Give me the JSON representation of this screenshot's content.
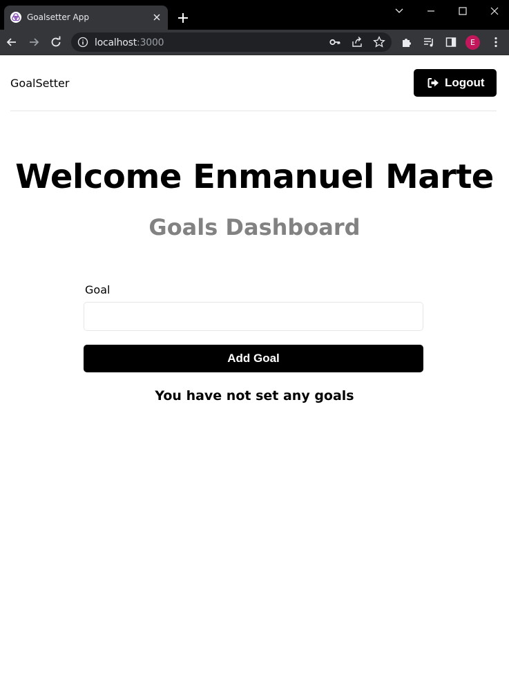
{
  "browser": {
    "tab_title": "Goalsetter App",
    "url_host": "localhost",
    "url_port": ":3000",
    "profile_initial": "E",
    "profile_color": "#c2185b",
    "icons": [
      "app-favicon-icon",
      "close-tab-icon",
      "new-tab-icon",
      "chevron-down-icon",
      "minimize-icon",
      "maximize-icon",
      "close-window-icon",
      "back-icon",
      "forward-icon",
      "reload-icon",
      "info-icon",
      "key-icon",
      "share-icon",
      "star-icon",
      "extensions-icon",
      "media-icon",
      "side-panel-icon",
      "menu-icon"
    ]
  },
  "header": {
    "brand": "GoalSetter",
    "logout_label": "Logout",
    "logout_icon": "sign-out-icon"
  },
  "main": {
    "welcome": "Welcome Enmanuel Marte",
    "subtitle": "Goals Dashboard",
    "form": {
      "goal_label": "Goal",
      "goal_value": "",
      "goal_placeholder": "",
      "submit_label": "Add Goal"
    },
    "empty_message": "You have not set any goals"
  },
  "colors": {
    "primary": "#000000",
    "subtitle": "#828282",
    "border": "#e6e6e6"
  }
}
